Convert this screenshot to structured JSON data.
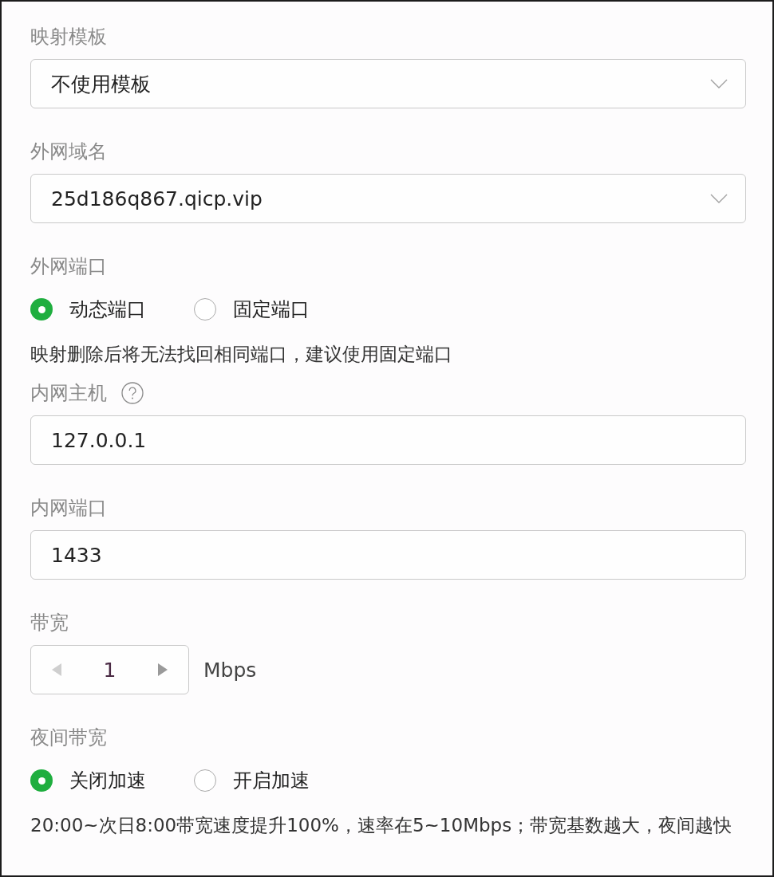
{
  "fields": [
    {
      "kind": "select",
      "label": "映射模板",
      "value": "不使用模板"
    },
    {
      "kind": "select",
      "label": "外网域名",
      "value": "25d186q867.qicp.vip"
    },
    {
      "kind": "radio",
      "label": "外网端口",
      "options": [
        {
          "label": "动态端口",
          "selected": true
        },
        {
          "label": "固定端口",
          "selected": false
        }
      ],
      "note": "映射删除后将无法找回相同端口，建议使用固定端口"
    },
    {
      "kind": "input",
      "label": "内网主机",
      "help": true,
      "value": "127.0.0.1"
    },
    {
      "kind": "input",
      "label": "内网端口",
      "value": "1433"
    },
    {
      "kind": "stepper",
      "label": "带宽",
      "value": "1",
      "unit": "Mbps",
      "decrease_disabled": true,
      "increase_disabled": false
    },
    {
      "kind": "radio",
      "label": "夜间带宽",
      "options": [
        {
          "label": "关闭加速",
          "selected": true
        },
        {
          "label": "开启加速",
          "selected": false
        }
      ],
      "note": "20:00~次日8:00带宽速度提升100%，速率在5~10Mbps；带宽基数越大，夜间越快"
    }
  ]
}
